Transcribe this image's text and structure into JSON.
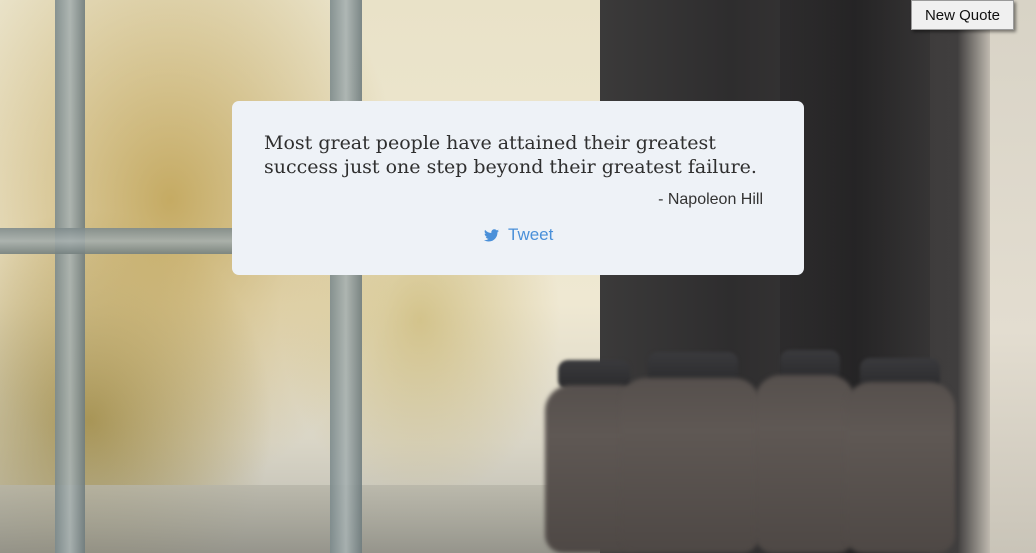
{
  "toolbar": {
    "new_quote_label": "New Quote"
  },
  "quote": {
    "text": "Most great people have attained their greatest success just one step beyond their greatest failure.",
    "author": "- Napoleon Hill"
  },
  "share": {
    "tweet_label": "Tweet",
    "tweet_icon": "twitter-bird-icon"
  },
  "colors": {
    "card_background": "#eef2f7",
    "tweet_link": "#4a90d9",
    "button_background": "#f0f0f0"
  }
}
